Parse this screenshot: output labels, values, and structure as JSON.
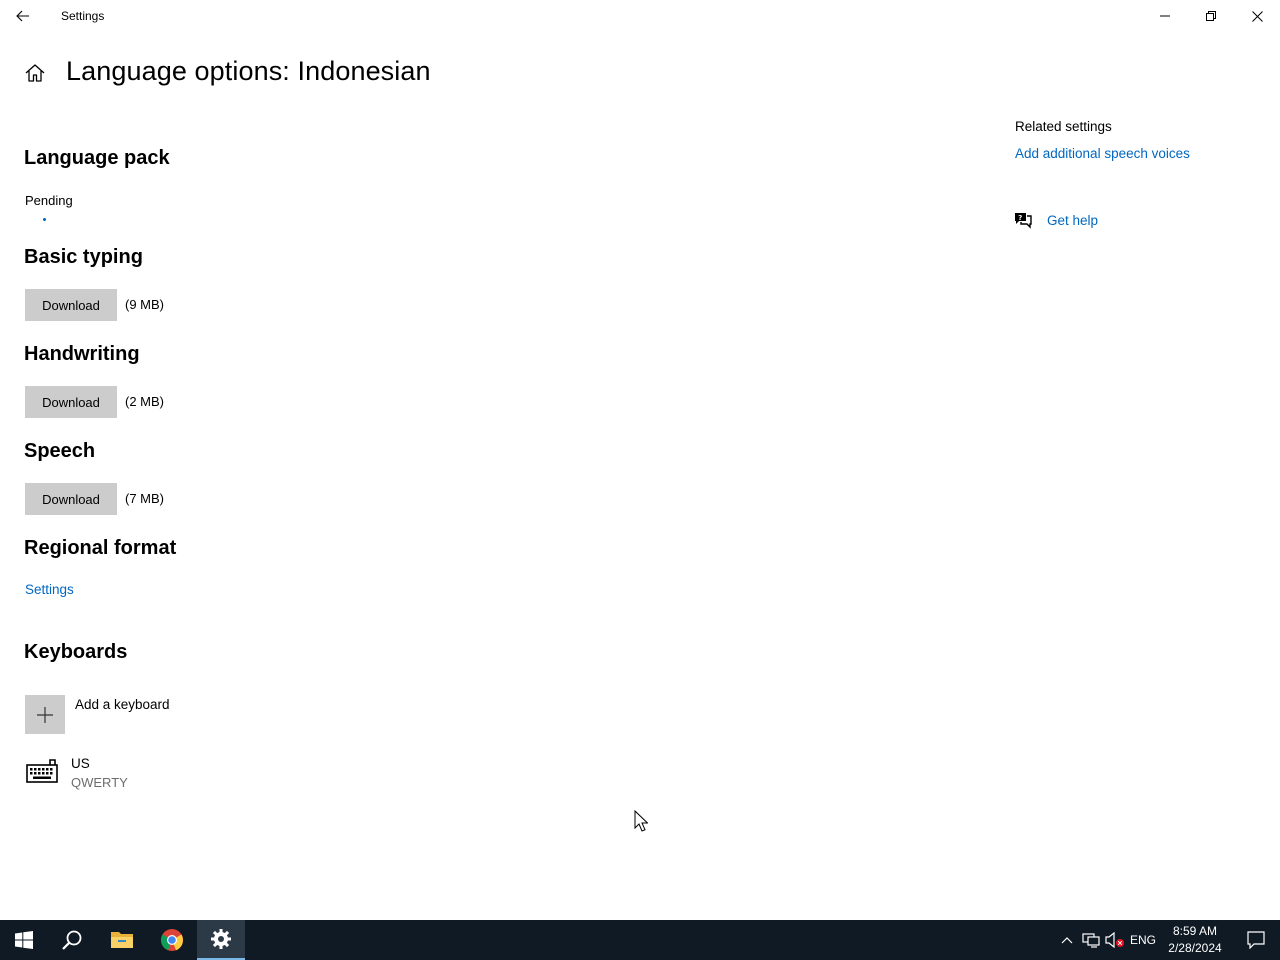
{
  "window": {
    "app_title": "Settings",
    "icons": {
      "back": "back-arrow-icon",
      "minimize": "minimize-icon",
      "restore": "restore-icon",
      "close": "close-icon"
    }
  },
  "page": {
    "title": "Language options: Indonesian",
    "home_icon": "home-icon"
  },
  "language_pack": {
    "heading": "Language pack",
    "status": "Pending"
  },
  "basic_typing": {
    "heading": "Basic typing",
    "button": "Download",
    "size": "(9 MB)"
  },
  "handwriting": {
    "heading": "Handwriting",
    "button": "Download",
    "size": "(2 MB)"
  },
  "speech": {
    "heading": "Speech",
    "button": "Download",
    "size": "(7 MB)"
  },
  "regional_format": {
    "heading": "Regional format",
    "link": "Settings"
  },
  "keyboards": {
    "heading": "Keyboards",
    "add_label": "Add a keyboard",
    "items": [
      {
        "name": "US",
        "layout": "QWERTY",
        "icon": "keyboard-icon"
      }
    ]
  },
  "related": {
    "heading": "Related settings",
    "link": "Add additional speech voices",
    "help_link": "Get help",
    "help_icon": "help-chat-icon"
  },
  "taskbar": {
    "apps": [
      "start-icon",
      "search-icon",
      "file-explorer-icon",
      "chrome-icon",
      "settings-gear-icon"
    ],
    "tray": {
      "language": "ENG",
      "time": "8:59 AM",
      "date": "2/28/2024"
    }
  },
  "colors": {
    "accent_link": "#0067c0",
    "taskbar_bg": "#101a24",
    "button_bg": "#cccccc",
    "secondary_text": "#6d6d6d"
  }
}
